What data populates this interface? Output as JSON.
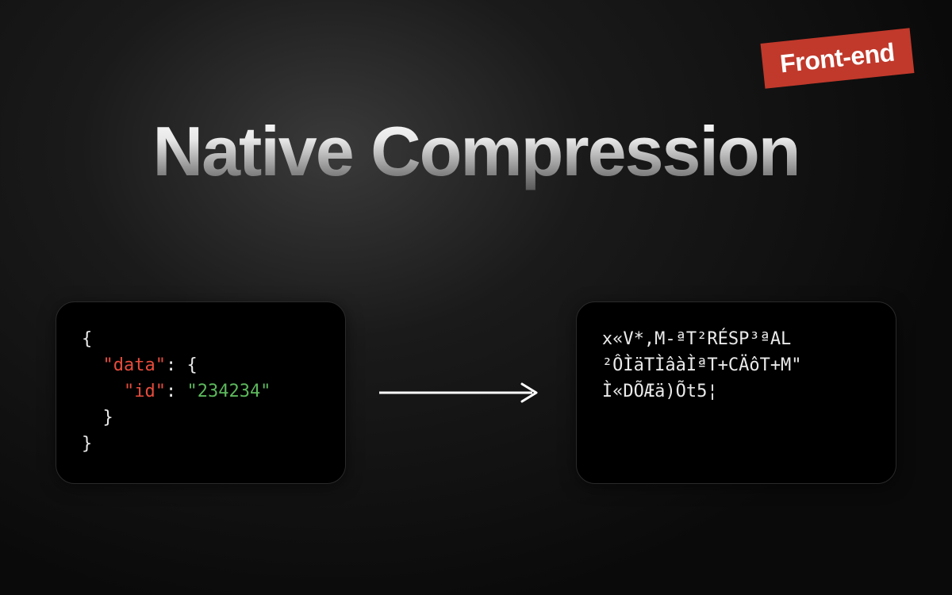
{
  "badge": "Front-end",
  "title": "Native Compression",
  "code": {
    "line1_open": "{",
    "line2_indent": "  ",
    "line2_key": "\"data\"",
    "line2_colon": ": ",
    "line2_open": "{",
    "line3_indent": "    ",
    "line3_key": "\"id\"",
    "line3_colon": ": ",
    "line3_value": "\"234234\"",
    "line4_indent": "  ",
    "line4_close": "}",
    "line5_close": "}"
  },
  "compressed": {
    "line1": "x«V*,M-ªT²RÉSP³ªAL",
    "line2": "²ÔÌäTÌâàÌªT+CÄôT+M\"",
    "line3": "Ì«DÕÆä)Õt5¦"
  }
}
